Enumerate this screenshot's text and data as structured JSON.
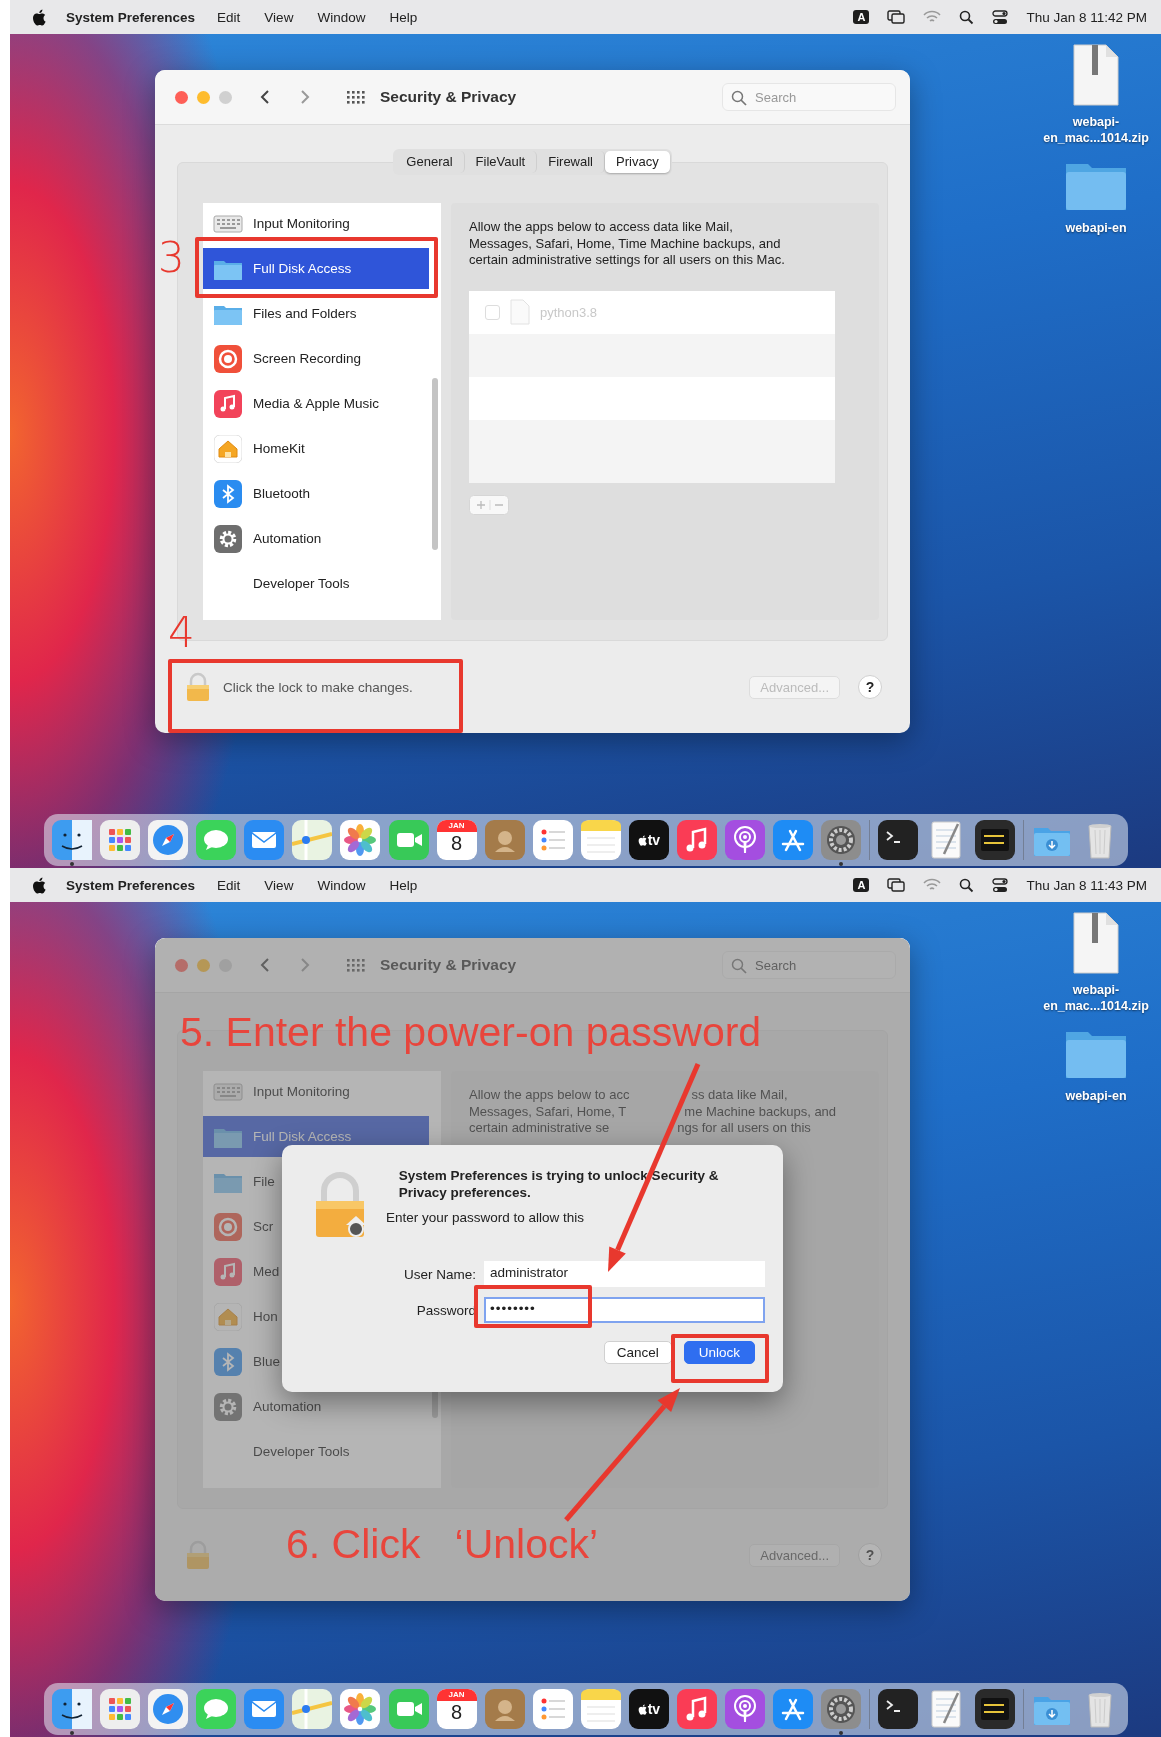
{
  "screens": [
    {
      "menu_bar": {
        "app": "System Preferences",
        "menus": [
          "Edit",
          "View",
          "Window",
          "Help"
        ],
        "input_source": "A",
        "clock": "Thu Jan 8  11:42 PM"
      },
      "desktop_items": [
        {
          "kind": "zip",
          "label": "webapi-en_mac...1014.zip"
        },
        {
          "kind": "folder",
          "label": "webapi-en"
        }
      ],
      "window": {
        "title": "Security & Privacy",
        "dimmed": false,
        "search": {
          "placeholder": "Search"
        },
        "tabs": [
          {
            "label": "General",
            "selected": false
          },
          {
            "label": "FileVault",
            "selected": false
          },
          {
            "label": "Firewall",
            "selected": false
          },
          {
            "label": "Privacy",
            "selected": true
          }
        ],
        "sidebar": {
          "items": [
            {
              "kind": "keyboard",
              "label": "Input Monitoring",
              "selected": false
            },
            {
              "kind": "folder",
              "label": "Full Disk Access",
              "selected": true
            },
            {
              "kind": "folder",
              "label": "Files and Folders",
              "selected": false
            },
            {
              "kind": "record",
              "label": "Screen Recording",
              "selected": false
            },
            {
              "kind": "music",
              "label": "Media & Apple Music",
              "selected": false
            },
            {
              "kind": "home",
              "label": "HomeKit",
              "selected": false
            },
            {
              "kind": "bluetooth",
              "label": "Bluetooth",
              "selected": false
            },
            {
              "kind": "gear",
              "label": "Automation",
              "selected": false
            },
            {
              "kind": "blank",
              "label": "Developer Tools",
              "selected": false
            }
          ]
        },
        "description": "Allow the apps below to access data like Mail, Messages, Safari, Home, Time Machine backups, and certain administrative settings for all users on this Mac.",
        "apps": [
          {
            "name": "python3.8",
            "checked": false
          }
        ],
        "lock_text": "Click the lock to make changes.",
        "advanced_button": {
          "label": "Advanced...",
          "disabled": true
        },
        "help_button": "?"
      },
      "annotations": [
        {
          "kind": "step",
          "text": "3"
        },
        {
          "kind": "highlight"
        },
        {
          "kind": "step",
          "text": "4"
        },
        {
          "kind": "highlight"
        }
      ],
      "dock": [
        {
          "kind": "finder",
          "running": true
        },
        {
          "kind": "launchpad"
        },
        {
          "kind": "safari"
        },
        {
          "kind": "messages"
        },
        {
          "kind": "mail"
        },
        {
          "kind": "maps"
        },
        {
          "kind": "photos"
        },
        {
          "kind": "facetime"
        },
        {
          "kind": "calendar",
          "month": "JAN",
          "day": "8"
        },
        {
          "kind": "contacts"
        },
        {
          "kind": "reminders"
        },
        {
          "kind": "notes"
        },
        {
          "kind": "tv",
          "label": "tv"
        },
        {
          "kind": "music"
        },
        {
          "kind": "podcasts"
        },
        {
          "kind": "appstore"
        },
        {
          "kind": "settings",
          "running": true
        },
        {
          "kind": "separator"
        },
        {
          "kind": "terminal"
        },
        {
          "kind": "textedit"
        },
        {
          "kind": "console"
        },
        {
          "kind": "separator"
        },
        {
          "kind": "downloads"
        },
        {
          "kind": "trash"
        }
      ]
    },
    {
      "menu_bar": {
        "app": "System Preferences",
        "menus": [
          "Edit",
          "View",
          "Window",
          "Help"
        ],
        "input_source": "A",
        "clock": "Thu Jan 8  11:43 PM"
      },
      "desktop_items": [
        {
          "kind": "zip",
          "label": "webapi-en_mac...1014.zip"
        },
        {
          "kind": "folder",
          "label": "webapi-en"
        }
      ],
      "window": {
        "title": "Security & Privacy",
        "dimmed": true,
        "search": {
          "placeholder": "Search"
        },
        "sidebar": {
          "items": [
            {
              "kind": "keyboard",
              "label": "Input Monitoring",
              "selected": false
            },
            {
              "kind": "folder",
              "label": "Full Disk Access",
              "selected": true
            },
            {
              "kind": "folder",
              "label": "File",
              "selected": false
            },
            {
              "kind": "record",
              "label": "Scr",
              "selected": false
            },
            {
              "kind": "music",
              "label": "Med",
              "selected": false
            },
            {
              "kind": "home",
              "label": "Hon",
              "selected": false
            },
            {
              "kind": "bluetooth",
              "label": "Blue",
              "selected": false
            },
            {
              "kind": "gear",
              "label": "Automation",
              "selected": false
            },
            {
              "kind": "blank",
              "label": "Developer Tools",
              "selected": false
            }
          ]
        },
        "description_lines": [
          [
            "Allow the apps below to acc",
            "ss data like Mail,"
          ],
          [
            "Messages, Safari, Home, T",
            "me Machine backups, and"
          ],
          [
            "certain administrative se",
            "ngs for all users on this"
          ]
        ],
        "advanced_button": {
          "label": "Advanced...",
          "disabled": true
        },
        "help_button": "?"
      },
      "dialog": {
        "title": "System Preferences is trying to unlock Security & Privacy preferences.",
        "message": "Enter your password to allow this",
        "fields": [
          {
            "kind": "text",
            "label": "User Name:",
            "value": "administrator",
            "focused": false
          },
          {
            "kind": "password",
            "label": "Password",
            "value": "••••••••",
            "focused": true
          }
        ],
        "buttons": [
          {
            "label": "Cancel",
            "default": false
          },
          {
            "label": "Unlock",
            "default": true
          }
        ]
      },
      "annotations": [
        {
          "kind": "caption",
          "text": "5. Enter the power-on password"
        },
        {
          "kind": "arrow"
        },
        {
          "kind": "highlight"
        },
        {
          "kind": "highlight"
        },
        {
          "kind": "arrow"
        },
        {
          "kind": "caption",
          "text": "6. Click   ‘Unlock’"
        }
      ],
      "dock": [
        {
          "kind": "finder",
          "running": true
        },
        {
          "kind": "launchpad"
        },
        {
          "kind": "safari"
        },
        {
          "kind": "messages"
        },
        {
          "kind": "mail"
        },
        {
          "kind": "maps"
        },
        {
          "kind": "photos"
        },
        {
          "kind": "facetime"
        },
        {
          "kind": "calendar",
          "month": "JAN",
          "day": "8"
        },
        {
          "kind": "contacts"
        },
        {
          "kind": "reminders"
        },
        {
          "kind": "notes"
        },
        {
          "kind": "tv",
          "label": "tv"
        },
        {
          "kind": "music"
        },
        {
          "kind": "podcasts"
        },
        {
          "kind": "appstore"
        },
        {
          "kind": "settings",
          "running": true
        },
        {
          "kind": "separator"
        },
        {
          "kind": "terminal"
        },
        {
          "kind": "textedit"
        },
        {
          "kind": "console"
        },
        {
          "kind": "separator"
        },
        {
          "kind": "downloads"
        },
        {
          "kind": "trash"
        }
      ]
    }
  ]
}
